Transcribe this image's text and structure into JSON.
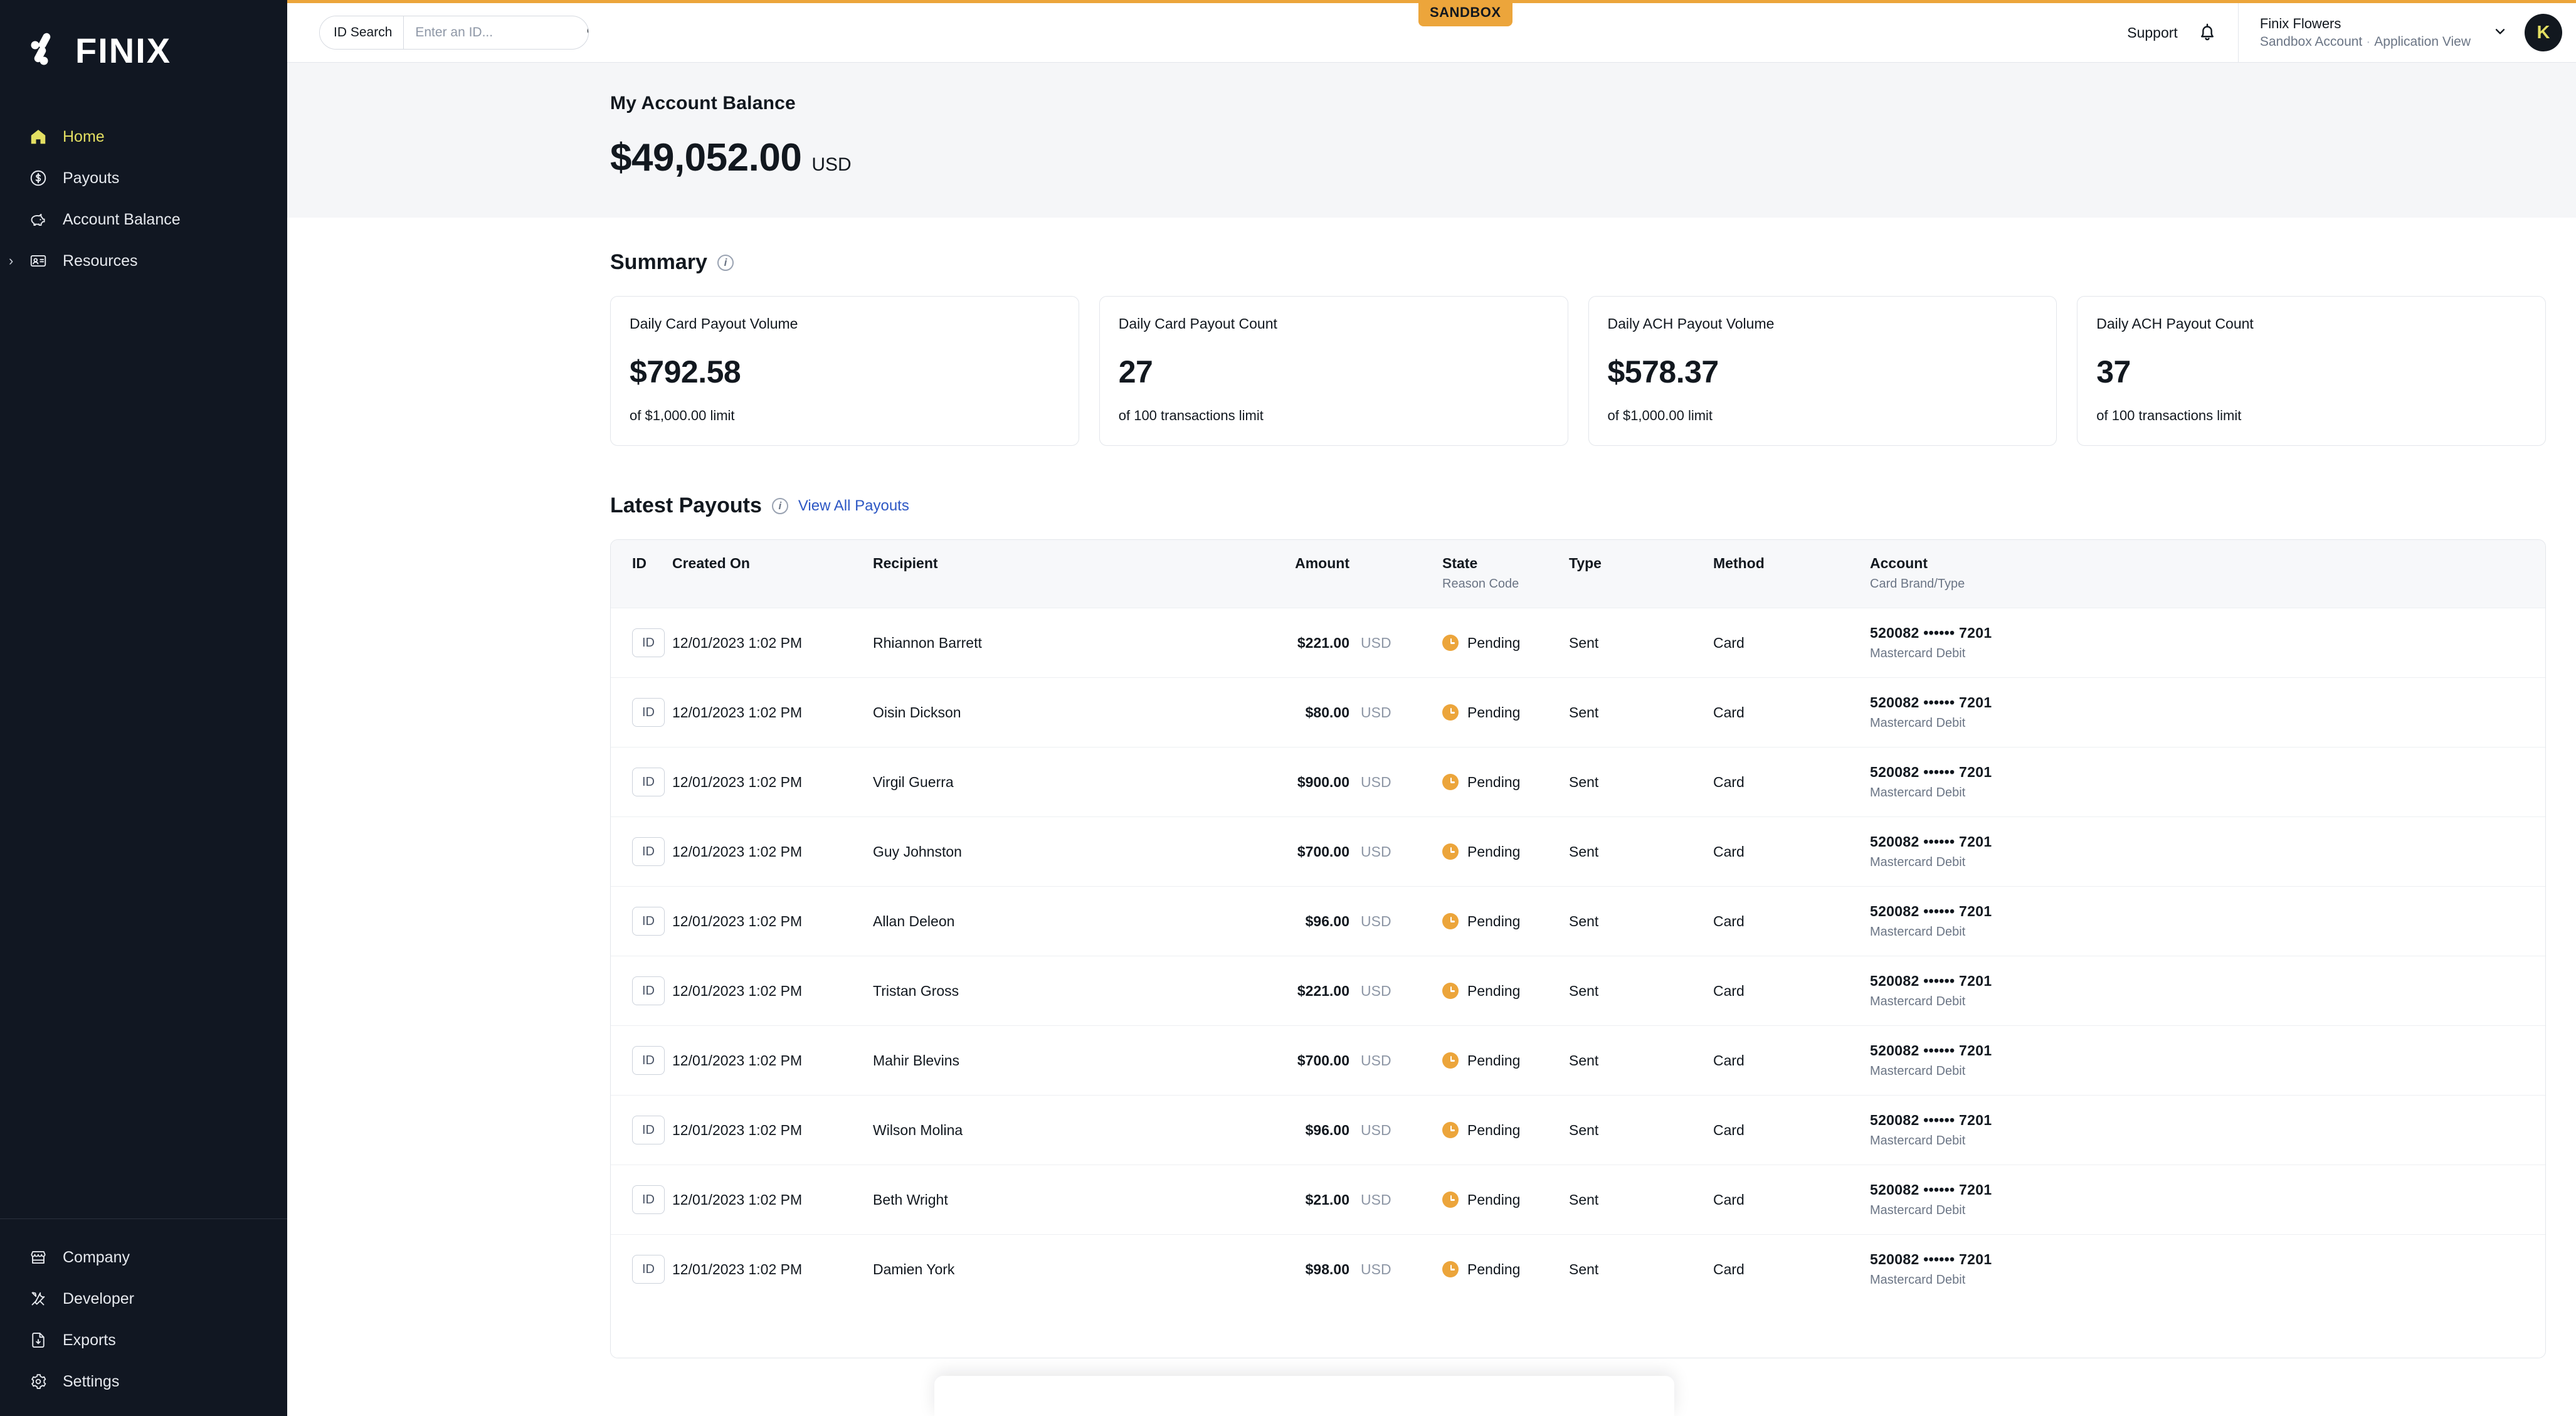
{
  "env_badge": {
    "label": "SANDBOX",
    "color": "#eca53b"
  },
  "brand": {
    "wordmark": "FINIX"
  },
  "sidebar": {
    "primary": [
      {
        "label": "Home",
        "icon": "home-icon",
        "active": true
      },
      {
        "label": "Payouts",
        "icon": "dollar-circle-icon",
        "active": false
      },
      {
        "label": "Account Balance",
        "icon": "piggy-bank-icon",
        "active": false
      },
      {
        "label": "Resources",
        "icon": "id-card-icon",
        "active": false,
        "expandable": true
      }
    ],
    "secondary": [
      {
        "label": "Company",
        "icon": "storefront-icon"
      },
      {
        "label": "Developer",
        "icon": "tools-icon"
      },
      {
        "label": "Exports",
        "icon": "file-download-icon"
      },
      {
        "label": "Settings",
        "icon": "gear-icon"
      }
    ]
  },
  "search": {
    "label": "ID Search",
    "placeholder": "Enter an ID...",
    "value": ""
  },
  "topbar": {
    "support": "Support",
    "account_name": "Finix Flowers",
    "account_type": "Sandbox Account",
    "account_view": "Application View",
    "avatar_initial": "K"
  },
  "balance": {
    "title": "My Account Balance",
    "amount": "$49,052.00",
    "currency": "USD"
  },
  "summary": {
    "title": "Summary",
    "cards": [
      {
        "label": "Daily Card Payout Volume",
        "value": "$792.58",
        "sub": "of $1,000.00 limit"
      },
      {
        "label": "Daily Card Payout Count",
        "value": "27",
        "sub": "of 100 transactions limit"
      },
      {
        "label": "Daily ACH Payout Volume",
        "value": "$578.37",
        "sub": "of $1,000.00 limit"
      },
      {
        "label": "Daily ACH Payout Count",
        "value": "37",
        "sub": "of 100 transactions limit"
      }
    ]
  },
  "latest_payouts": {
    "title": "Latest Payouts",
    "view_all_label": "View All Payouts",
    "columns": {
      "id": "ID",
      "created_on": "Created On",
      "recipient": "Recipient",
      "amount": "Amount",
      "state": "State",
      "state_sub": "Reason Code",
      "type": "Type",
      "method": "Method",
      "account": "Account",
      "account_sub": "Card Brand/Type"
    },
    "id_badge_label": "ID",
    "rows": [
      {
        "created_on": "12/01/2023 1:02 PM",
        "recipient": "Rhiannon Barrett",
        "amount": "$221.00",
        "currency": "USD",
        "state": "Pending",
        "type": "Sent",
        "method": "Card",
        "account": "520082 •••••• 7201",
        "account_brand": "Mastercard Debit"
      },
      {
        "created_on": "12/01/2023 1:02 PM",
        "recipient": "Oisin Dickson",
        "amount": "$80.00",
        "currency": "USD",
        "state": "Pending",
        "type": "Sent",
        "method": "Card",
        "account": "520082 •••••• 7201",
        "account_brand": "Mastercard Debit"
      },
      {
        "created_on": "12/01/2023 1:02 PM",
        "recipient": "Virgil Guerra",
        "amount": "$900.00",
        "currency": "USD",
        "state": "Pending",
        "type": "Sent",
        "method": "Card",
        "account": "520082 •••••• 7201",
        "account_brand": "Mastercard Debit"
      },
      {
        "created_on": "12/01/2023 1:02 PM",
        "recipient": "Guy Johnston",
        "amount": "$700.00",
        "currency": "USD",
        "state": "Pending",
        "type": "Sent",
        "method": "Card",
        "account": "520082 •••••• 7201",
        "account_brand": "Mastercard Debit"
      },
      {
        "created_on": "12/01/2023 1:02 PM",
        "recipient": "Allan Deleon",
        "amount": "$96.00",
        "currency": "USD",
        "state": "Pending",
        "type": "Sent",
        "method": "Card",
        "account": "520082 •••••• 7201",
        "account_brand": "Mastercard Debit"
      },
      {
        "created_on": "12/01/2023 1:02 PM",
        "recipient": "Tristan Gross",
        "amount": "$221.00",
        "currency": "USD",
        "state": "Pending",
        "type": "Sent",
        "method": "Card",
        "account": "520082 •••••• 7201",
        "account_brand": "Mastercard Debit"
      },
      {
        "created_on": "12/01/2023 1:02 PM",
        "recipient": "Mahir Blevins",
        "amount": "$700.00",
        "currency": "USD",
        "state": "Pending",
        "type": "Sent",
        "method": "Card",
        "account": "520082 •••••• 7201",
        "account_brand": "Mastercard Debit"
      },
      {
        "created_on": "12/01/2023 1:02 PM",
        "recipient": "Wilson Molina",
        "amount": "$96.00",
        "currency": "USD",
        "state": "Pending",
        "type": "Sent",
        "method": "Card",
        "account": "520082 •••••• 7201",
        "account_brand": "Mastercard Debit"
      },
      {
        "created_on": "12/01/2023 1:02 PM",
        "recipient": "Beth Wright",
        "amount": "$21.00",
        "currency": "USD",
        "state": "Pending",
        "type": "Sent",
        "method": "Card",
        "account": "520082 •••••• 7201",
        "account_brand": "Mastercard Debit"
      },
      {
        "created_on": "12/01/2023 1:02 PM",
        "recipient": "Damien York",
        "amount": "$98.00",
        "currency": "USD",
        "state": "Pending",
        "type": "Sent",
        "method": "Card",
        "account": "520082 •••••• 7201",
        "account_brand": "Mastercard Debit"
      }
    ]
  }
}
